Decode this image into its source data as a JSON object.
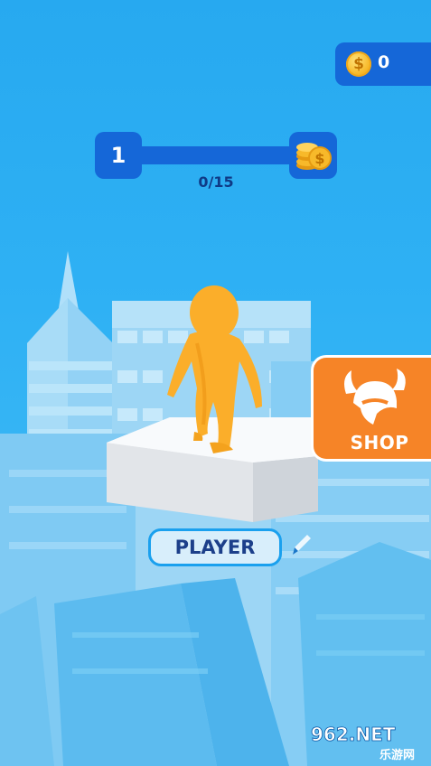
{
  "hud": {
    "coins": "0",
    "coin_icon": "dollar-coin-icon",
    "level": "1",
    "progress_text": "0/15",
    "progress_fraction": 0.0,
    "reward_icon": "coin-stack-icon"
  },
  "shop": {
    "label": "SHOP",
    "icon": "viking-helmet-icon"
  },
  "player": {
    "name": "PLAYER",
    "edit_icon": "pencil-icon"
  },
  "watermark": {
    "site": "962.NET",
    "tagline": "乐游网"
  },
  "colors": {
    "sky": "#2aabf2",
    "hud_blue": "#1567d8",
    "shop_orange": "#f68427",
    "character": "#fdb22e"
  }
}
